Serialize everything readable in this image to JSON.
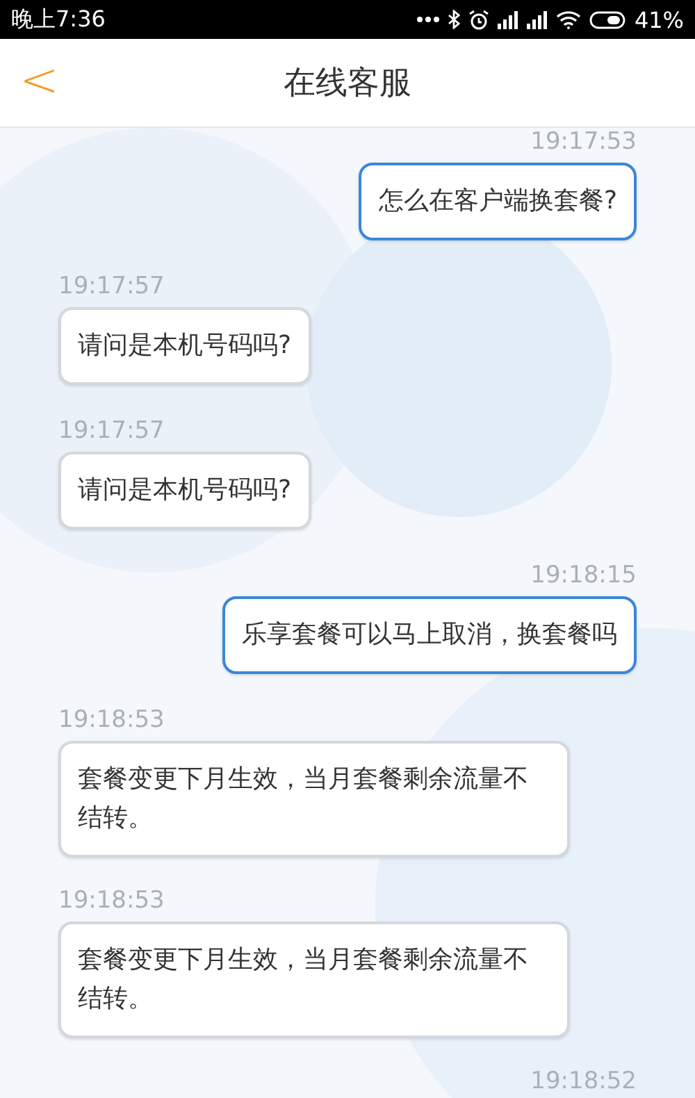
{
  "status_bar": {
    "time": "晚上7:36",
    "battery": "41%"
  },
  "header": {
    "back": "<",
    "title": "在线客服"
  },
  "messages": [
    {
      "kind": "sent",
      "time": "19:17:53",
      "text": "怎么在客户端换套餐?"
    },
    {
      "kind": "received",
      "time": "19:17:57",
      "text": "请问是本机号码吗?"
    },
    {
      "kind": "received",
      "time": "19:17:57",
      "text": "请问是本机号码吗?"
    },
    {
      "kind": "sent",
      "time": "19:18:15",
      "text": "乐享套餐可以马上取消，换套餐吗"
    },
    {
      "kind": "received",
      "time": "19:18:53",
      "text": "套餐变更下月生效，当月套餐剩余流量不结转。"
    },
    {
      "kind": "received",
      "time": "19:18:53",
      "text": "套餐变更下月生效，当月套餐剩余流量不结转。"
    },
    {
      "kind": "sent",
      "time": "19:18:52"
    }
  ]
}
